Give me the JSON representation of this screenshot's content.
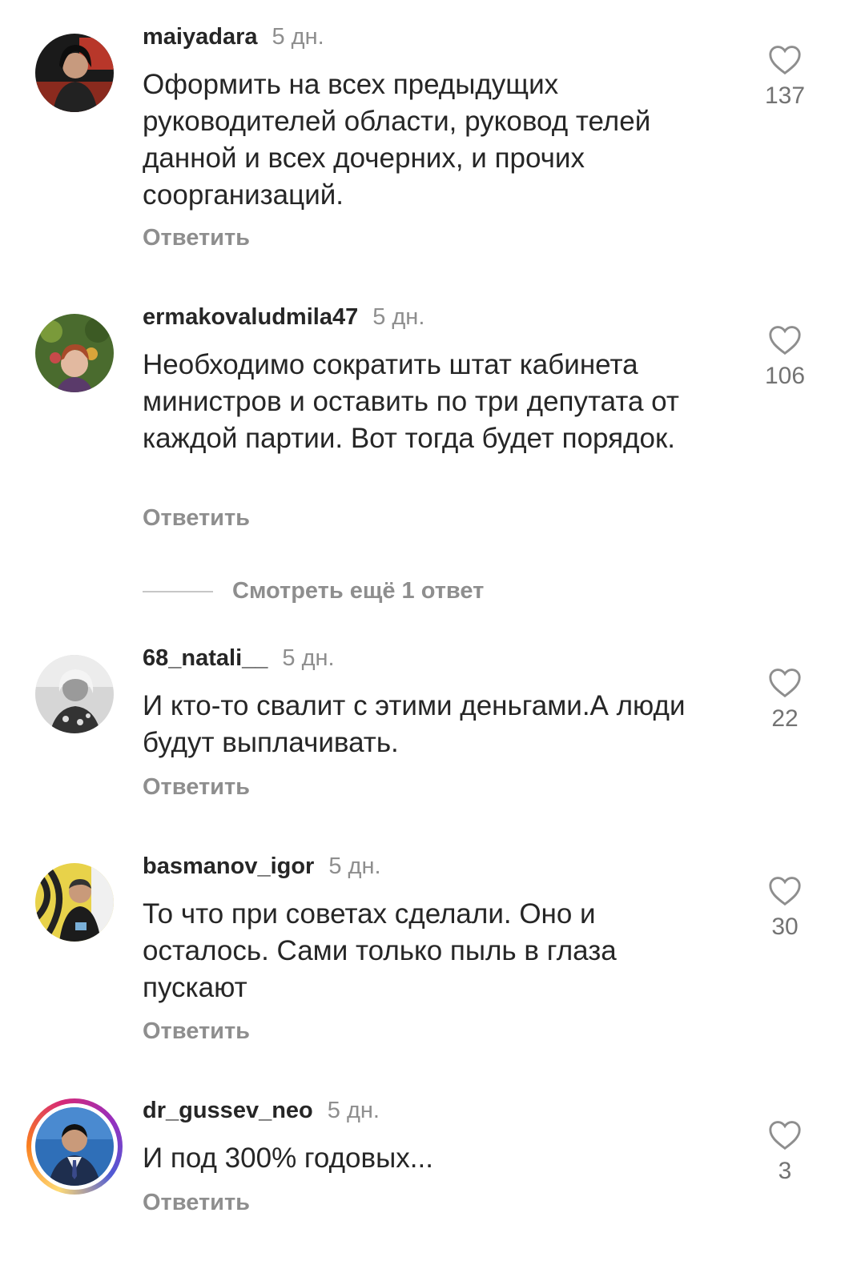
{
  "comments": [
    {
      "username": "maiyadara",
      "time": "5 дн.",
      "text": "Оформить на всех предыдущих руководителей области, руковод телей данной и всех  дочерних, и прочих соорганизаций.",
      "reply_label": "Ответить",
      "likes": "137",
      "avatar": "avatar-maiyadara"
    },
    {
      "username": "ermakovaludmila47",
      "time": "5 дн.",
      "text": "Необходимо сократить штат кабинета министров и оставить по три  депутата от каждой партии. Вот тогда будет порядок.",
      "reply_label": "Ответить",
      "likes": "106",
      "avatar": "avatar-ermakovaludmila47"
    },
    {
      "username": "68_natali__",
      "time": "5 дн.",
      "text": "И кто-то свалит с этими деньгами.А люди будут выплачивать.",
      "reply_label": "Ответить",
      "likes": "22",
      "avatar": "avatar-68-natali"
    },
    {
      "username": "basmanov_igor",
      "time": "5 дн.",
      "text": "То что при советах сделали. Оно и осталось. Сами только пыль в глаза пускают",
      "reply_label": "Ответить",
      "likes": "30",
      "avatar": "avatar-basmanov-igor"
    },
    {
      "username": "dr_gussev_neo",
      "time": "5 дн.",
      "text": "И под 300% годовых...",
      "reply_label": "Ответить",
      "likes": "3",
      "avatar": "avatar-dr-gussev-neo"
    }
  ],
  "view_more_replies": "Смотреть ещё 1 ответ",
  "icons": {
    "like": "heart-icon"
  },
  "colors": {
    "text": "#262626",
    "secondary": "#8e8e8e",
    "divider": "#c7c7c7",
    "background": "#ffffff"
  }
}
